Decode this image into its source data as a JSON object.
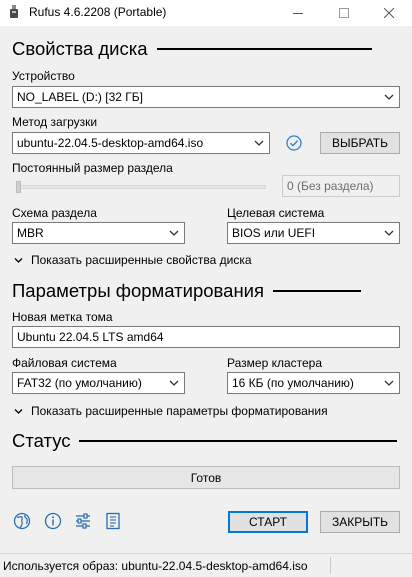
{
  "window": {
    "title": "Rufus 4.6.2208 (Portable)",
    "minimize_glyph": "—",
    "maximize_glyph": "☐",
    "close_glyph": "✕"
  },
  "drive_section": {
    "title": "Свойства диска",
    "device_label": "Устройство",
    "device_value": "NO_LABEL (D:) [32 ГБ]",
    "boot_label": "Метод загрузки",
    "boot_value": "ubuntu-22.04.5-desktop-amd64.iso",
    "select_button": "ВЫБРАТЬ",
    "persistent_label": "Постоянный размер раздела",
    "persistent_value": "0 (Без раздела)",
    "partition_label": "Схема раздела",
    "partition_value": "MBR",
    "target_label": "Целевая система",
    "target_value": "BIOS или UEFI",
    "advanced_toggle": "Показать расширенные свойства диска"
  },
  "format_section": {
    "title": "Параметры форматирования",
    "volume_label": "Новая метка тома",
    "volume_value": "Ubuntu 22.04.5 LTS amd64",
    "fs_label": "Файловая система",
    "fs_value": "FAT32 (по умолчанию)",
    "cluster_label": "Размер кластера",
    "cluster_value": "16 КБ (по умолчанию)",
    "advanced_toggle": "Показать расширенные параметры форматирования"
  },
  "status_section": {
    "title": "Статус",
    "progress_text": "Готов",
    "progress_fraction": 0
  },
  "actions": {
    "start": "СТАРТ",
    "close": "ЗАКРЫТЬ"
  },
  "toolbar_icons": [
    "globe-icon",
    "info-icon",
    "settings-sliders-icon",
    "log-icon"
  ],
  "statusbar": {
    "text": "Используется образ: ubuntu-22.04.5-desktop-amd64.iso"
  },
  "colors": {
    "accent": "#0078d7",
    "background": "#f0f0f0"
  }
}
